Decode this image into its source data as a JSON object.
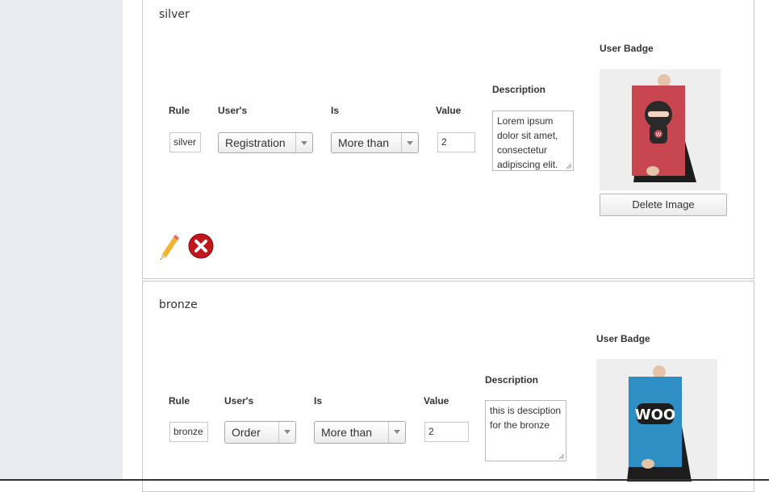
{
  "rules": [
    {
      "name": "silver",
      "headers": {
        "rule": "Rule",
        "users": "User's",
        "is": "Is",
        "value": "Value",
        "description": "Description",
        "badge": "User Badge"
      },
      "rule_value": "silver",
      "users_select": "Registration",
      "is_select": "More than",
      "value": "2",
      "description": "Lorem ipsum dolor sit amet, consectetur adipiscing elit.",
      "delete_image_label": "Delete Image",
      "badge_text": "W"
    },
    {
      "name": "bronze",
      "headers": {
        "rule": "Rule",
        "users": "User's",
        "is": "Is",
        "value": "Value",
        "description": "Description",
        "badge": "User Badge"
      },
      "rule_value": "bronze",
      "users_select": "Order",
      "is_select": "More than",
      "value": "2",
      "description": "this is desciption for the bronze",
      "badge_text": "WOO"
    }
  ],
  "icons": {
    "edit": "pencil-icon",
    "delete": "delete-x-icon"
  },
  "colors": {
    "sidebar": "#e9ecf1",
    "badge_red": "#c8464f",
    "badge_blue": "#2f8fc4",
    "delete_red": "#c0161c"
  }
}
